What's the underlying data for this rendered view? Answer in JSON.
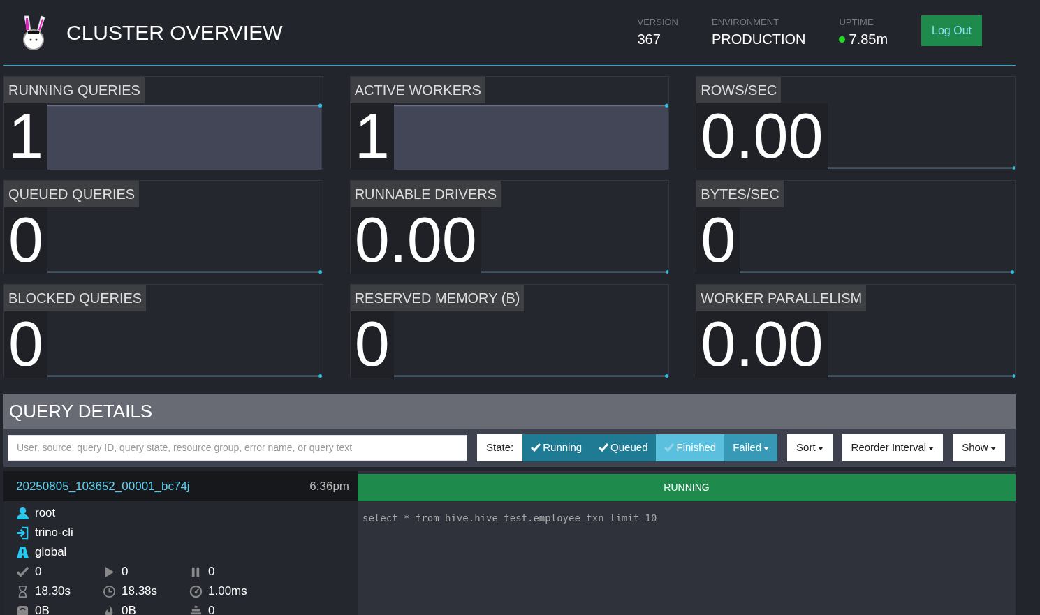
{
  "header": {
    "title": "CLUSTER OVERVIEW",
    "stats": [
      {
        "label": "VERSION",
        "value": "367",
        "kind": "plain"
      },
      {
        "label": "ENVIRONMENT",
        "value": "PRODUCTION",
        "kind": "plain"
      },
      {
        "label": "UPTIME",
        "value": "7.85m",
        "kind": "status",
        "color": "#22dd22"
      }
    ],
    "logout": "Log Out"
  },
  "tiles": [
    {
      "label": "RUNNING QUERIES",
      "value": "1",
      "kind": "area"
    },
    {
      "label": "ACTIVE WORKERS",
      "value": "1",
      "kind": "area"
    },
    {
      "label": "ROWS/SEC",
      "value": "0.00",
      "kind": "line"
    },
    {
      "label": "QUEUED QUERIES",
      "value": "0",
      "kind": "line"
    },
    {
      "label": "RUNNABLE DRIVERS",
      "value": "0.00",
      "kind": "line"
    },
    {
      "label": "BYTES/SEC",
      "value": "0",
      "kind": "line"
    },
    {
      "label": "BLOCKED QUERIES",
      "value": "0",
      "kind": "line"
    },
    {
      "label": "RESERVED MEMORY (B)",
      "value": "0",
      "kind": "line"
    },
    {
      "label": "WORKER PARALLELISM",
      "value": "0.00",
      "kind": "line"
    }
  ],
  "query_details": {
    "title": "QUERY DETAILS",
    "search": {
      "placeholder": "User, source, query ID, query state, resource group, error name, or query text"
    },
    "state_label": "State:",
    "state_filters": [
      {
        "label": "Running",
        "kind": "toggle",
        "checked": true
      },
      {
        "label": "Queued",
        "kind": "toggle",
        "checked": true
      },
      {
        "label": "Finished",
        "kind": "toggle",
        "checked": false
      },
      {
        "label": "Failed",
        "kind": "dropdown",
        "checked": false
      }
    ],
    "menus": [
      "Sort",
      "Reorder Interval",
      "Show"
    ],
    "queries": [
      {
        "id": "20250805_103652_00001_bc74j",
        "time": "6:36pm",
        "state": "RUNNING",
        "color": "#1e8a4c",
        "info": [
          "root",
          "trino-cli",
          "global"
        ],
        "stats": [
          "0",
          "0",
          "0",
          "18.30s",
          "18.38s",
          "1.00ms",
          "0B",
          "0B",
          "0"
        ],
        "sql": "select * from hive.hive_test.employee_txn  limit 10"
      }
    ]
  }
}
